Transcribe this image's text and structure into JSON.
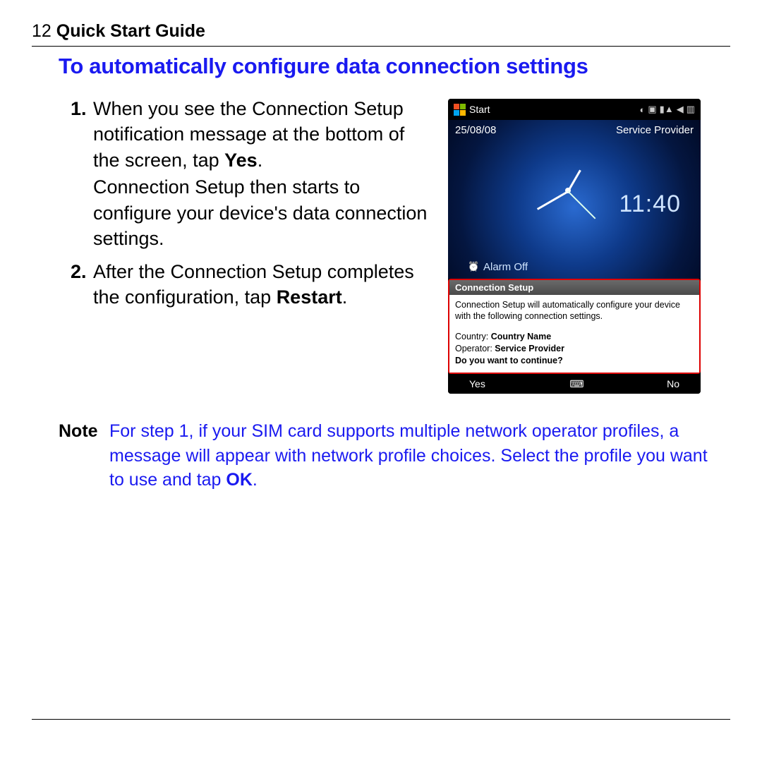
{
  "header": {
    "page_number": "12",
    "title": "Quick Start Guide"
  },
  "section_heading": "To automatically configure data connection settings",
  "steps": [
    {
      "number": "1.",
      "para1_pre": "When you see the Connection Setup notification message at the bottom of the screen, tap ",
      "para1_bold": "Yes",
      "para1_post": ".",
      "para2": "Connection Setup then starts to configure your device's data connection settings."
    },
    {
      "number": "2.",
      "para1_pre": "After the Connection Setup completes the configuration, tap ",
      "para1_bold": "Restart",
      "para1_post": "."
    }
  ],
  "phone": {
    "start_label": "Start",
    "date": "25/08/08",
    "service": "Service Provider",
    "time": "11:40",
    "alarm": "Alarm Off",
    "notification": {
      "title": "Connection Setup",
      "message": "Connection Setup will automatically configure your device with the following connection settings.",
      "country_label": "Country:",
      "country_value": "Country Name",
      "operator_label": "Operator:",
      "operator_value": "Service Provider",
      "prompt": "Do you want to continue?"
    },
    "softkeys": {
      "left": "Yes",
      "right": "No"
    }
  },
  "note": {
    "label": "Note",
    "text_pre": "For step 1, if your SIM card supports multiple network operator profiles, a message will appear with network profile choices. Select the profile you want to use and tap ",
    "text_bold": "OK",
    "text_post": "."
  }
}
